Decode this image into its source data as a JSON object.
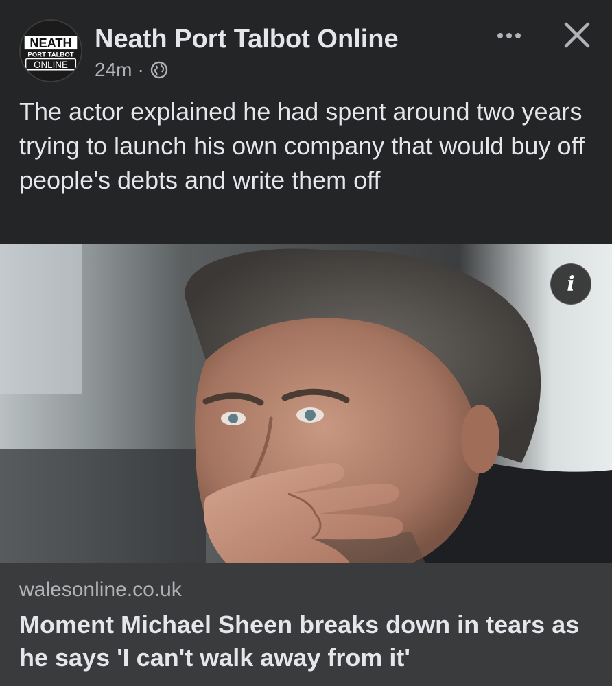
{
  "post": {
    "page_name": "Neath Port Talbot Online",
    "timestamp": "24m",
    "separator": "·",
    "privacy_icon": "globe-icon",
    "more_icon": "more-horizontal-icon",
    "close_icon": "close-icon",
    "caption": "The actor explained he had spent around two years trying to launch his own company that would buy off people's debts and write them off"
  },
  "avatar": {
    "logo_line1": "NEATH",
    "logo_line2": "PORT TALBOT",
    "logo_line3": "ONLINE"
  },
  "media": {
    "info_label": "i",
    "info_icon": "info-icon"
  },
  "link_preview": {
    "domain": "walesonline.co.uk",
    "headline": "Moment Michael Sheen breaks down in tears as he says 'I can't walk away from it'"
  },
  "colors": {
    "background": "#242526",
    "link_box": "#3a3b3c",
    "primary_text": "#e4e6eb",
    "secondary_text": "#b0b3b8"
  }
}
